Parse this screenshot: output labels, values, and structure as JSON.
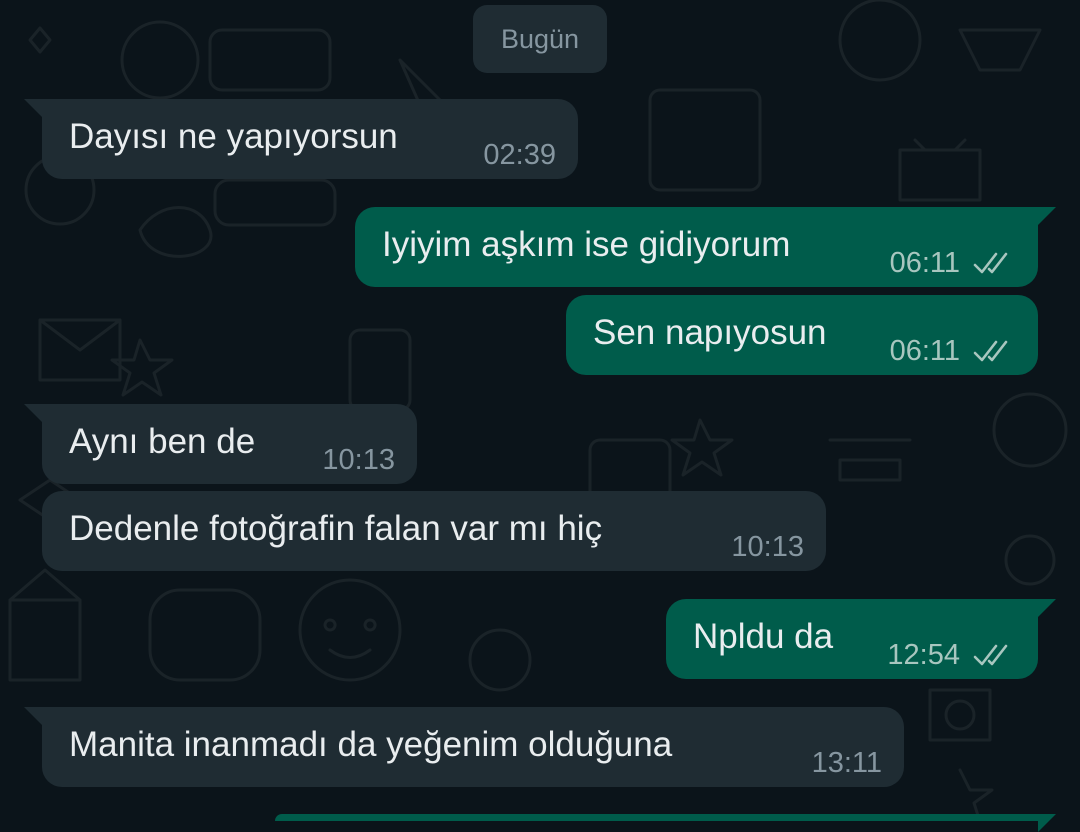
{
  "date_separator": "Bugün",
  "messages": [
    {
      "direction": "in",
      "text": "Dayısı ne yapıyorsun",
      "time": "02:39",
      "first": true
    },
    {
      "direction": "out",
      "text": "Iyiyim aşkım ise gidiyorum",
      "time": "06:11",
      "first": true,
      "status_icon": "double-check-icon"
    },
    {
      "direction": "out",
      "text": "Sen napıyosun",
      "time": "06:11",
      "first": false,
      "status_icon": "double-check-icon"
    },
    {
      "direction": "in",
      "text": "Aynı ben de",
      "time": "10:13",
      "first": true
    },
    {
      "direction": "in",
      "text": "Dedenle fotoğrafin falan var mı hiç",
      "time": "10:13",
      "first": false
    },
    {
      "direction": "out",
      "text": "Npldu da",
      "time": "12:54",
      "first": true,
      "status_icon": "double-check-icon"
    },
    {
      "direction": "in",
      "text": "Manita inanmadı da yeğenim olduğuna",
      "time": "13:11",
      "first": true
    }
  ],
  "colors": {
    "background": "#0b141a",
    "incoming_bubble": "#1f2c33",
    "outgoing_bubble": "#005c4b",
    "message_text": "#e9edef",
    "incoming_time": "#8696a0",
    "outgoing_time": "#a8c6bf"
  }
}
